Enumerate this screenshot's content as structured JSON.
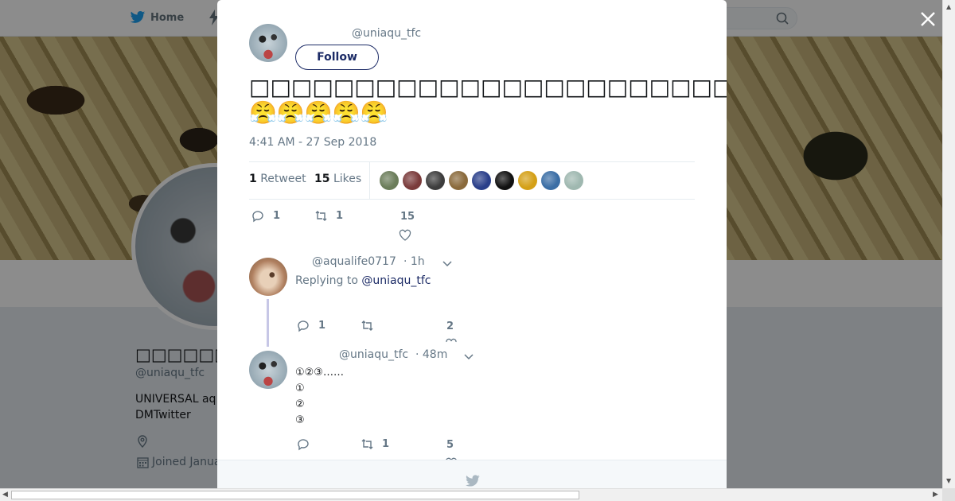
{
  "background": {
    "nav_home": "Home",
    "profile_name": "□□□□□□□□□□",
    "profile_handle": "@uniaqu_tfc",
    "bio": "UNIVERSAL aq DMTwitter",
    "joined": "Joined Janua"
  },
  "modal": {
    "author_handle": "@uniaqu_tfc",
    "follow_label": "Follow",
    "tweet_text": "□□□□□□□□□□□□□□□□□□□□□□□□□□□□□□□□□□□□□□□□□□□□□□□□□□□□□□□□□□□□□□□□□□□□□□□□□□□□□□□□□□□□□□□□□□□□□□😤😤😤😤😤",
    "timestamp": "4:41 AM - 27 Sep 2018",
    "retweet_count": "1",
    "retweet_label": "Retweet",
    "likes_count": "15",
    "likes_label": "Likes",
    "liker_colors": [
      "#6b7d5a",
      "#7a3b3b",
      "#3d3d3d",
      "#8a6a3c",
      "#2a3f8a",
      "#111111",
      "#d4a017",
      "#3b6ea5",
      "#9fb8b0"
    ],
    "actions": {
      "replies": "1",
      "retweets": "1",
      "likes": "15"
    }
  },
  "replies": [
    {
      "handle": "@aqualife0717",
      "time": "· 1h",
      "replying_prefix": "Replying to",
      "replying_to": "@uniaqu_tfc",
      "actions": {
        "replies": "1",
        "retweets": "",
        "likes": "2"
      }
    },
    {
      "handle": "@uniaqu_tfc",
      "time": "· 48m",
      "text": "①②③……\n①\n②\n③",
      "actions": {
        "replies": "",
        "retweets": "1",
        "likes": "5"
      }
    }
  ]
}
